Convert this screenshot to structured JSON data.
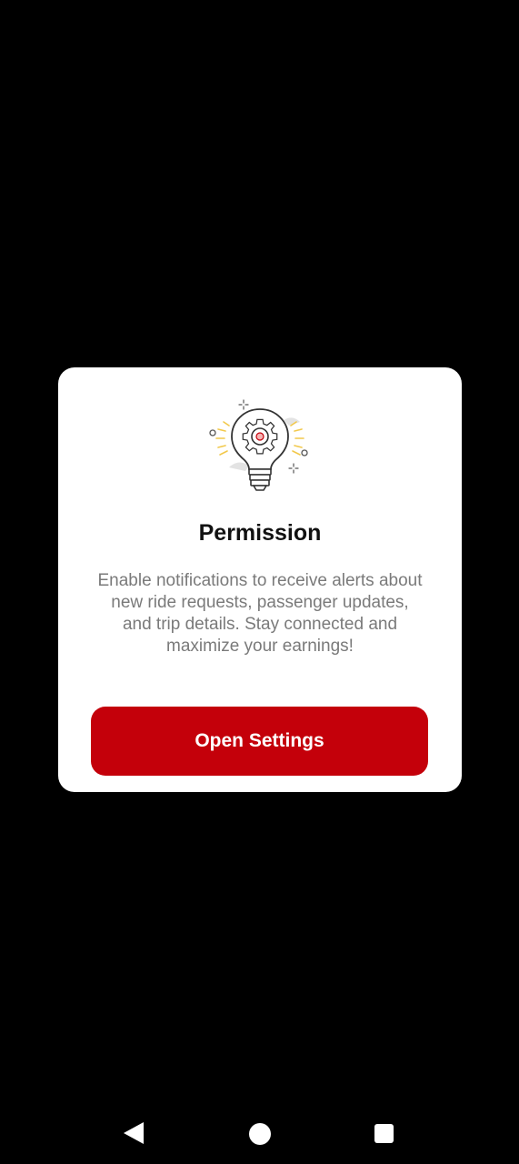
{
  "dialog": {
    "title": "Permission",
    "message": "Enable notifications to receive alerts about new ride requests, passenger updates, and trip details. Stay connected and maximize your earnings!",
    "primary_button": "Open Settings",
    "illustration_icon": "lightbulb-gear-icon"
  },
  "navigation": {
    "back_icon": "back-triangle-icon",
    "home_icon": "home-circle-icon",
    "recents_icon": "recents-square-icon"
  },
  "colors": {
    "overlay": "#000000",
    "dialog_background": "#ffffff",
    "accent": "#c4000a",
    "title_text": "#111111",
    "body_text": "#7a7a7a",
    "illustration_highlight": "#f2c94c"
  }
}
